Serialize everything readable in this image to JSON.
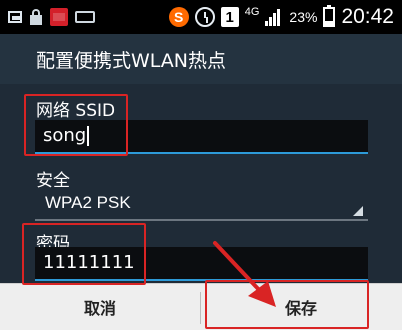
{
  "status_bar": {
    "network_type": "4G",
    "battery_percent": "23%",
    "time": "20:42",
    "left_icons": [
      "image-icon",
      "lock-icon",
      "app-icon",
      "keyboard-icon"
    ],
    "right_icons": [
      "sogou-icon",
      "alarm-icon",
      "notification-one-icon",
      "signal-icon",
      "battery-icon"
    ],
    "sogou_glyph": "S",
    "one_glyph": "1"
  },
  "dialog": {
    "title": "配置便携式WLAN热点",
    "ssid_label": "网络 SSID",
    "ssid_value": "song",
    "security_label": "安全",
    "security_value": "WPA2 PSK",
    "password_label": "密码",
    "password_value": "11111111"
  },
  "buttons": {
    "cancel": "取消",
    "save": "保存"
  },
  "colors": {
    "highlight": "#d92424",
    "accent": "#2d9ad8",
    "dialog_background": "#1f2b37"
  }
}
